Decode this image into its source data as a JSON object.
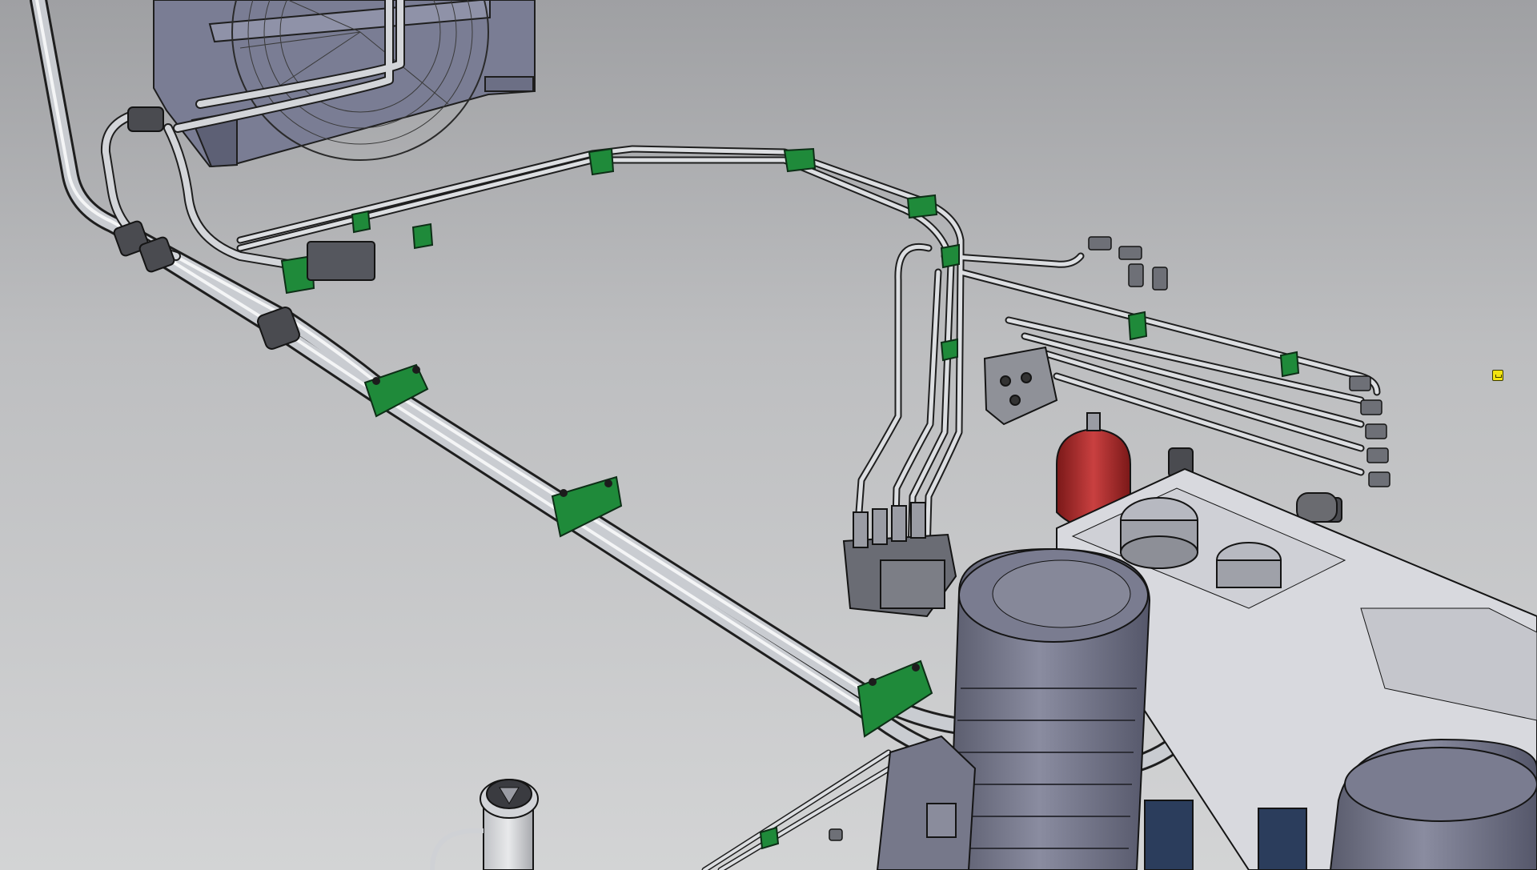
{
  "scene": {
    "kind": "hydraulic-power-unit-3d-cad-render",
    "colors": {
      "background_top": "#9fa0a3",
      "background_bottom": "#d3d4d5",
      "pipe": "#c9ccd1",
      "pipe_edge": "#1e1e1e",
      "clamp": "#1f8a3a",
      "motor": "#6f7184",
      "accumulator": "#a82a2a",
      "cooler_frame": "#7a7d94",
      "tank_top": "#d8d9de",
      "marker": "#f2e40f"
    },
    "components": [
      "oil-cooler-fan",
      "main-pipe-run",
      "pipe-clamps",
      "directional-valve-bank",
      "manifold-block",
      "bladder-accumulator",
      "electric-motor",
      "reservoir-tank",
      "return-filter",
      "tank-breather"
    ],
    "icons": [
      "selection-marker-icon"
    ]
  }
}
